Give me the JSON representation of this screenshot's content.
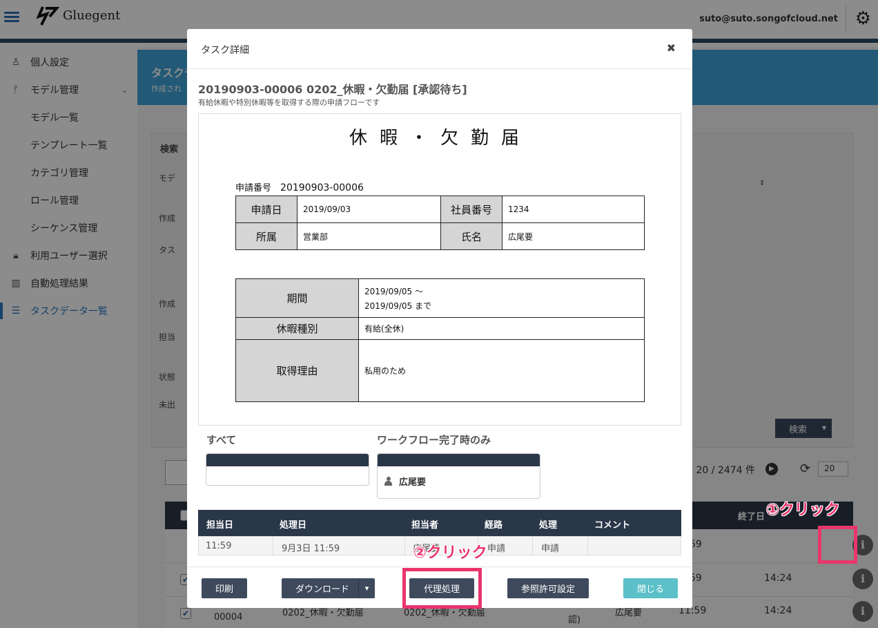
{
  "header": {
    "logo": "Gluegent",
    "user": "suto@suto.songofcloud.net"
  },
  "sidebar": {
    "items": [
      {
        "label": "個人設定",
        "icon": "person-icon"
      },
      {
        "label": "モデル管理",
        "icon": "branch-icon"
      },
      {
        "label": "モデル一覧"
      },
      {
        "label": "テンプレート一覧"
      },
      {
        "label": "カテゴリ管理"
      },
      {
        "label": "ロール管理"
      },
      {
        "label": "シーケンス管理"
      },
      {
        "label": "利用ユーザー選択",
        "icon": "lock-icon"
      },
      {
        "label": "自動処理結果",
        "icon": "bar-chart-icon"
      },
      {
        "label": "タスクデータ一覧",
        "icon": "list-icon"
      }
    ]
  },
  "page": {
    "banner_title": "タスクデ",
    "banner_sub": "作成され",
    "search_title": "検索",
    "filter_labels": [
      "モデ",
      "作成",
      "タス",
      "作成",
      "担当",
      "状態",
      "未出"
    ],
    "search_button": "検索",
    "pager": "- 20 / 2474 件",
    "page_size": "20",
    "end_col": "終了日",
    "rows": [
      {
        "time1": "59",
        "time2": ""
      },
      {
        "time1": "59",
        "time2": "14:24"
      },
      {
        "id": "00004",
        "model": "0202_休暇・欠勤届",
        "template": "0202_休暇・欠勤届",
        "note": "認)",
        "person": "広尾要",
        "time1": "11:59",
        "time2": "14:24"
      }
    ]
  },
  "modal": {
    "title": "タスク詳細",
    "task_title": "20190903-00006 0202_休暇・欠勤届 [承認待ち]",
    "task_sub": "有給休暇や特別休暇等を取得する際の申請フローです",
    "form": {
      "title": "休暇・欠勤届",
      "number_label": "申請番号",
      "number": "20190903-00006",
      "apply_date_label": "申請日",
      "apply_date": "2019/09/03",
      "emp_no_label": "社員番号",
      "emp_no": "1234",
      "dept_label": "所属",
      "dept": "営業部",
      "name_label": "氏名",
      "name": "広尾要",
      "period_label": "期間",
      "period_from": "2019/09/05 〜",
      "period_to": "2019/09/05 まで",
      "leave_type_label": "休暇種別",
      "leave_type": "有給(全休)",
      "reason_label": "取得理由",
      "reason": "私用のため"
    },
    "notify_all": "すべて",
    "notify_complete": "ワークフロー完了時のみ",
    "notify_person": "広尾要",
    "history": {
      "headers": [
        "担当日",
        "処理日",
        "担当者",
        "経路",
        "処理",
        "コメント"
      ],
      "row": [
        "11:59",
        "9月3日 11:59",
        "広尾要",
        "申請",
        "申請",
        ""
      ]
    },
    "buttons": {
      "print": "印刷",
      "download": "ダウンロード",
      "proxy": "代理処理",
      "access": "参照許可設定",
      "close": "閉じる"
    }
  },
  "annotations": {
    "step1": "①クリック",
    "step2": "②クリック"
  }
}
